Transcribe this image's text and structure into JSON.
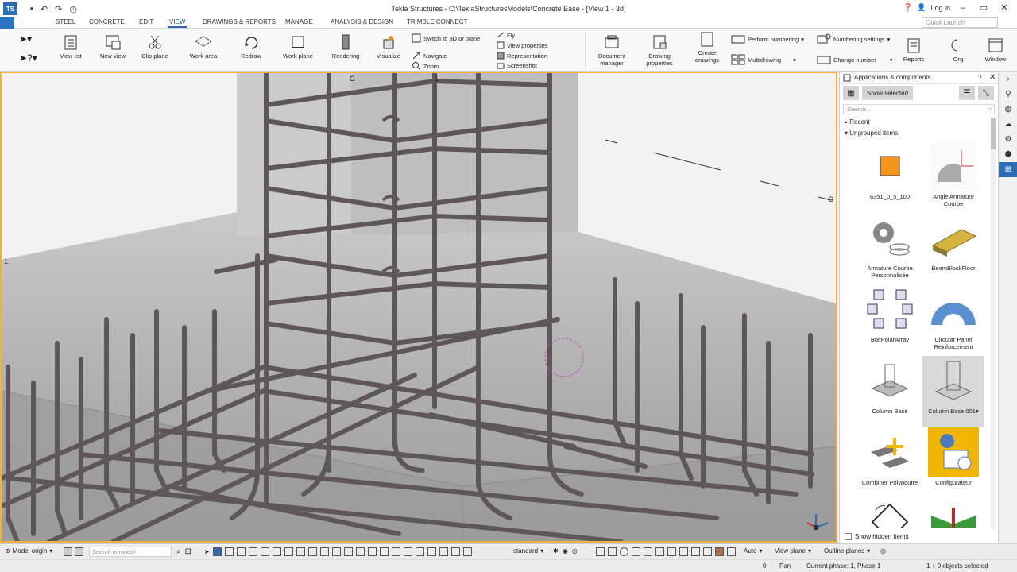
{
  "titlebar": {
    "title": "Tekla Structures - C:\\TeklaStructuresModels\\Concrete Base - [View 1 - 3d]",
    "login": "Log in",
    "help_icon": "help-icon",
    "app_icon": "TS"
  },
  "tabs": [
    {
      "label": "STEEL"
    },
    {
      "label": "CONCRETE"
    },
    {
      "label": "EDIT"
    },
    {
      "label": "VIEW",
      "active": true
    },
    {
      "label": "DRAWINGS & REPORTS"
    },
    {
      "label": "MANAGE"
    },
    {
      "label": "ANALYSIS & DESIGN"
    },
    {
      "label": "TRIMBLE CONNECT"
    }
  ],
  "quick_launch": {
    "placeholder": "Quick Launch"
  },
  "ribbon": {
    "view_list": "View list",
    "new_view": "New view",
    "clip_plane": "Clip plane",
    "work_area": "Work area",
    "redraw": "Redraw",
    "work_plane": "Work plane",
    "rendering": "Rendering",
    "visualize": "Visualize",
    "switch_3d": "Switch to 3D or plane",
    "navigate": "Navigate",
    "zoom": "Zoom",
    "fly": "Fly",
    "view_properties": "View properties",
    "representation": "Representation",
    "screenshot": "Screenshot",
    "document_manager": [
      "Document",
      "manager"
    ],
    "drawing_properties": [
      "Drawing",
      "properties"
    ],
    "create_drawings": [
      "Create",
      "drawings"
    ],
    "perform_numbering": "Perform numbering",
    "multidrawing": "Multidrawing",
    "numbering_settings": "Numbering settings",
    "change_number": "Change number",
    "reports": "Reports",
    "org": "Org",
    "window": "Window"
  },
  "viewport": {
    "grid_labels": [
      "G",
      "1",
      "G",
      "1"
    ]
  },
  "panel": {
    "title": "Applications & components",
    "show_selected": "Show selected",
    "search_placeholder": "Search...",
    "tree": {
      "recent": "Recent",
      "ungrouped": "Ungrouped items"
    },
    "items": [
      {
        "label": "6351_0_5_100",
        "icon": "orange-square"
      },
      {
        "label": "Angle Armature Courbe",
        "icon": "angle-armature"
      },
      {
        "label": "Armature Courbe Personnalisée",
        "icon": "gear-stack"
      },
      {
        "label": "BeamBlockFloor",
        "icon": "beam-block"
      },
      {
        "label": "BoltPolarArray",
        "icon": "bolt-polar"
      },
      {
        "label": "Circular Panel Reinforcement",
        "icon": "circular-panel"
      },
      {
        "label": "Column Base",
        "icon": "column-base"
      },
      {
        "label": "Column Base 001",
        "icon": "column-base-001",
        "selected": true
      },
      {
        "label": "Combiner Polypoutre",
        "icon": "combiner"
      },
      {
        "label": "Configurateur",
        "icon": "configurateur"
      },
      {
        "label": "",
        "icon": "frame-rotate"
      },
      {
        "label": "",
        "icon": "green-beam"
      }
    ],
    "show_hidden": "Show hidden items"
  },
  "statusbar": {
    "model_origin": "Model origin",
    "search_placeholder": "Search in model",
    "standard": "standard",
    "auto": "Auto",
    "view_plane": "View plane",
    "outline_planes": "Outline planes",
    "count": "0",
    "mode": "Pan",
    "phase": "Current phase: 1, Phase 1",
    "selection": "1 + 0 objects selected"
  },
  "colors": {
    "accent": "#2a6db5",
    "viewport_border": "#f2b233",
    "rebar": "#5f5757",
    "concrete": "#a9a9a9"
  }
}
